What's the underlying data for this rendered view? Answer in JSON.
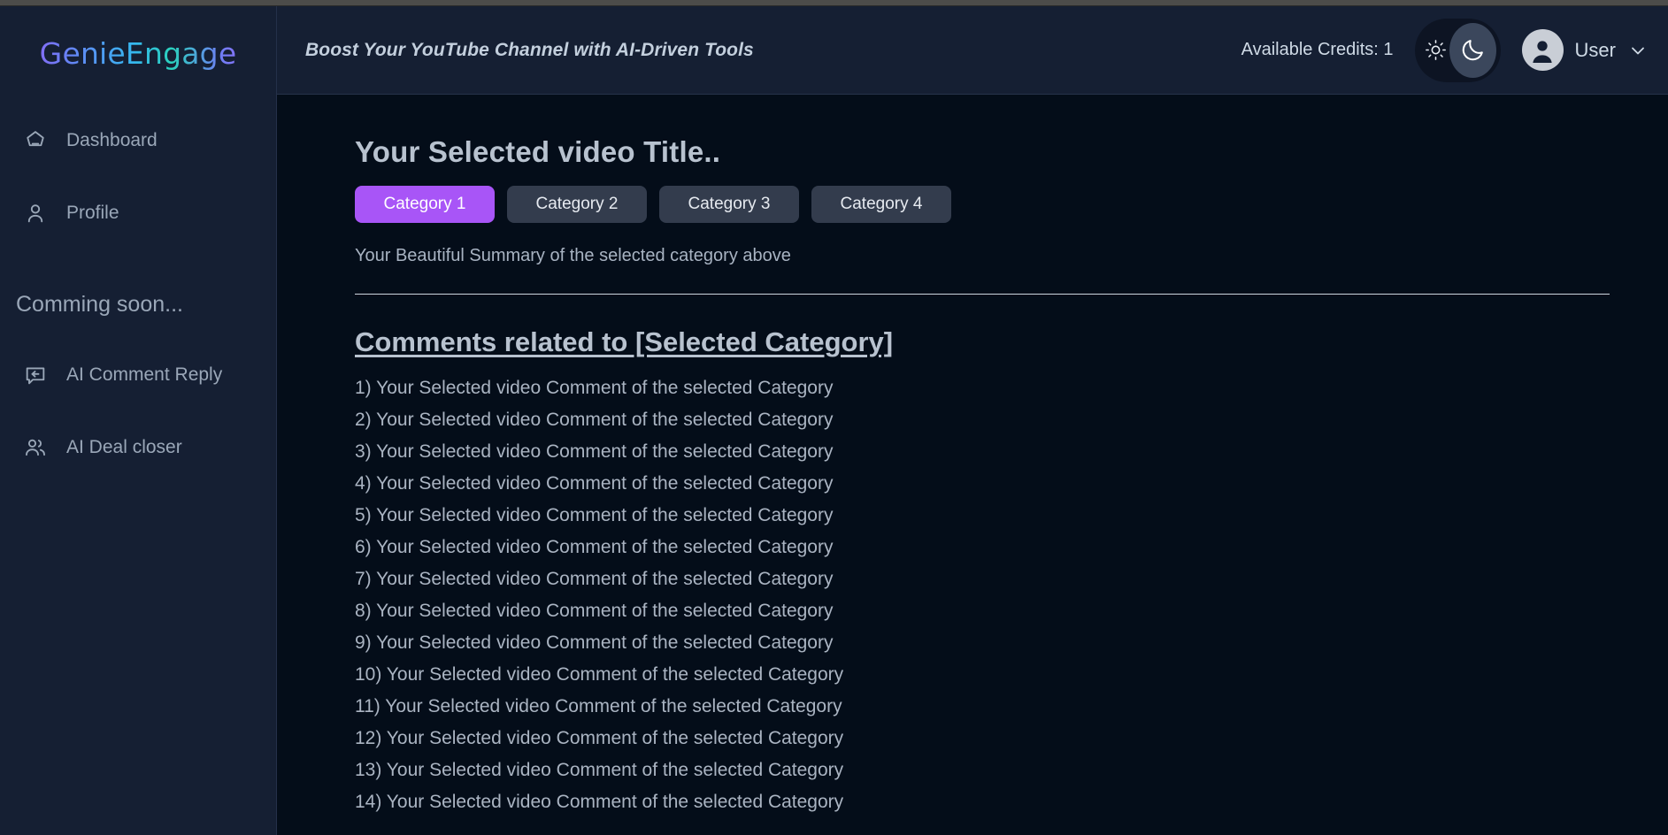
{
  "app": {
    "logo_text": "GenieEngage"
  },
  "sidebar": {
    "primary_items": [
      {
        "label": "Dashboard",
        "icon": "dashboard-pentagon-icon"
      },
      {
        "label": "Profile",
        "icon": "user-icon"
      }
    ],
    "coming_soon_label": "Comming soon...",
    "secondary_items": [
      {
        "label": "AI Comment Reply",
        "icon": "comment-reply-icon"
      },
      {
        "label": "AI Deal closer",
        "icon": "users-icon"
      }
    ]
  },
  "header": {
    "tagline": "Boost Your YouTube Channel with AI-Driven Tools",
    "credits_label": "Available Credits: 1",
    "theme_toggle": {
      "light_icon": "sun-icon",
      "dark_icon": "moon-icon",
      "active": "dark"
    },
    "user": {
      "name": "User",
      "avatar_icon": "avatar-icon",
      "chevron_icon": "chevron-down-icon"
    }
  },
  "main": {
    "video_title": "Your Selected video Title..",
    "categories": [
      {
        "label": "Category 1",
        "active": true
      },
      {
        "label": "Category 2",
        "active": false
      },
      {
        "label": "Category 3",
        "active": false
      },
      {
        "label": "Category 4",
        "active": false
      }
    ],
    "summary": "Your Beautiful Summary of the selected category above",
    "comments_heading": "Comments related to [Selected Category]",
    "comments": [
      "1) Your Selected video Comment of the selected Category",
      "2) Your Selected video Comment of the selected Category",
      "3) Your Selected video Comment of the selected Category",
      "4) Your Selected video Comment of the selected Category",
      "5) Your Selected video Comment of the selected Category",
      "6) Your Selected video Comment of the selected Category",
      "7) Your Selected video Comment of the selected Category",
      "8) Your Selected video Comment of the selected Category",
      "9) Your Selected video Comment of the selected Category",
      "10) Your Selected video Comment of the selected Category",
      "11) Your Selected video Comment of the selected Category",
      "12) Your Selected video Comment of the selected Category",
      "13) Your Selected video Comment of the selected Category",
      "14) Your Selected video Comment of the selected Category"
    ]
  },
  "colors": {
    "accent_purple": "#a855f7",
    "sidebar_bg": "#151f33",
    "main_bg": "#040d19",
    "button_gray": "#333c4d"
  }
}
